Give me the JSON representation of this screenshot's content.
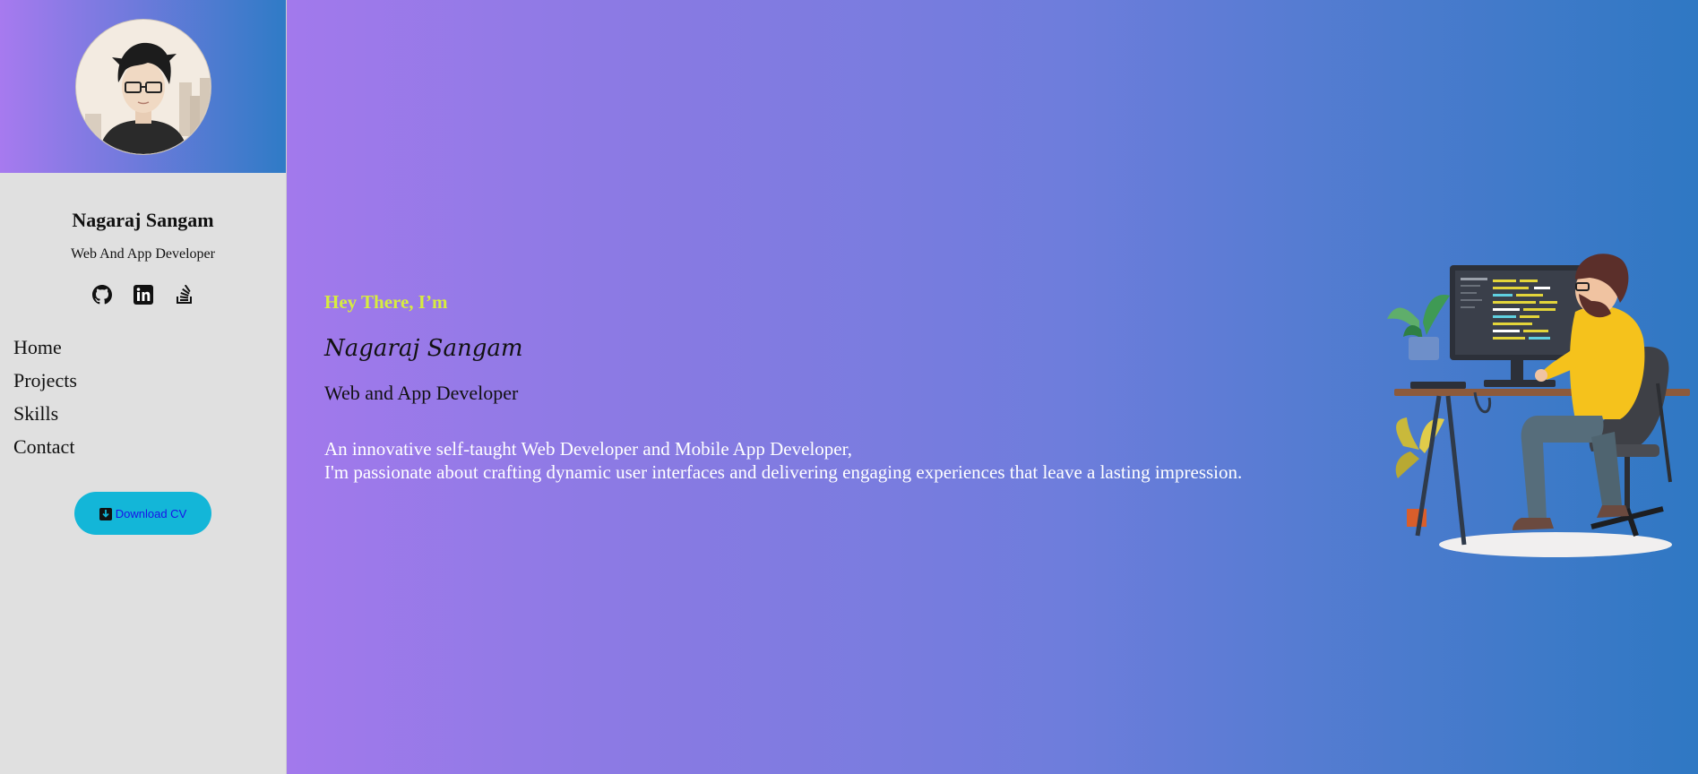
{
  "sidebar": {
    "name": "Nagaraj Sangam",
    "role": "Web And App Developer",
    "social": [
      {
        "icon": "github-icon"
      },
      {
        "icon": "linkedin-icon"
      },
      {
        "icon": "stackoverflow-icon"
      }
    ],
    "nav": [
      "Home",
      "Projects",
      "Skills",
      "Contact"
    ],
    "download_label": "Download CV"
  },
  "hero": {
    "greeting": "Hey There, I’m",
    "name": "Nagaraj Sangam",
    "role": "Web and App Developer",
    "desc_line1": "An innovative self-taught Web Developer and Mobile App Developer,",
    "desc_line2": "I'm passionate about crafting dynamic user interfaces and delivering engaging experiences that leave a lasting impression."
  },
  "colors": {
    "sidebar_bg": "#e0e0e0",
    "header_gradient_start": "#a77aef",
    "header_gradient_end": "#2f7bc6",
    "greeting": "#d7ec3f",
    "download_button": "#13b6d8",
    "download_text": "#1a12e8"
  }
}
